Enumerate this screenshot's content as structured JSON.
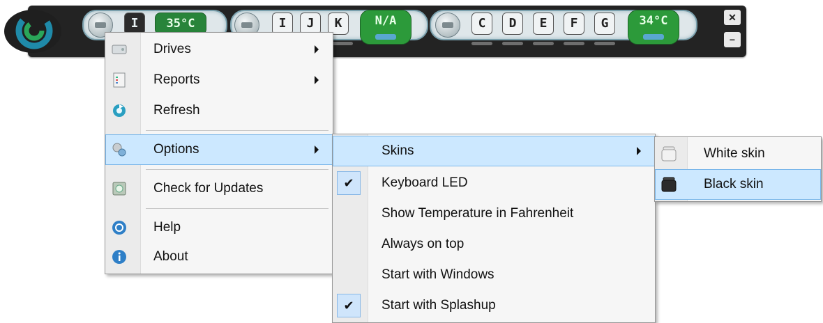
{
  "toolbar": {
    "temp1": "35°C",
    "temp2": "34°C",
    "na": "N/A",
    "keys_group1": [
      "I"
    ],
    "keys_group2": [
      "I",
      "J",
      "K"
    ],
    "keys_group3": [
      "C",
      "D",
      "E",
      "F",
      "G"
    ],
    "close_label": "✕",
    "minimize_label": "−"
  },
  "main_menu": {
    "items": [
      {
        "label": "Drives",
        "icon": "drive-icon",
        "submenu": true
      },
      {
        "label": "Reports",
        "icon": "report-icon",
        "submenu": true
      },
      {
        "label": "Refresh",
        "icon": "refresh-icon",
        "submenu": false
      },
      {
        "label": "Options",
        "icon": "gear-icon",
        "submenu": true
      },
      {
        "label": "Check for Updates",
        "icon": "update-icon",
        "submenu": false
      },
      {
        "label": "Help",
        "icon": "help-icon",
        "submenu": false
      },
      {
        "label": "About",
        "icon": "info-icon",
        "submenu": false
      }
    ]
  },
  "options_menu": {
    "items": [
      {
        "label": "Skins",
        "checked": false,
        "submenu": true
      },
      {
        "label": "Keyboard LED",
        "checked": true,
        "submenu": false
      },
      {
        "label": "Show Temperature in Fahrenheit",
        "checked": false,
        "submenu": false
      },
      {
        "label": "Always on top",
        "checked": false,
        "submenu": false
      },
      {
        "label": "Start with Windows",
        "checked": false,
        "submenu": false
      },
      {
        "label": "Start with Splashup",
        "checked": true,
        "submenu": false
      }
    ]
  },
  "skins_menu": {
    "items": [
      {
        "label": "White skin",
        "icon": "white-skin-icon"
      },
      {
        "label": "Black skin",
        "icon": "black-skin-icon"
      }
    ]
  },
  "colors": {
    "highlight": "#cce8ff",
    "highlight_border": "#7ab7ea",
    "bar": "#232323",
    "green": "#2f9a3a"
  }
}
